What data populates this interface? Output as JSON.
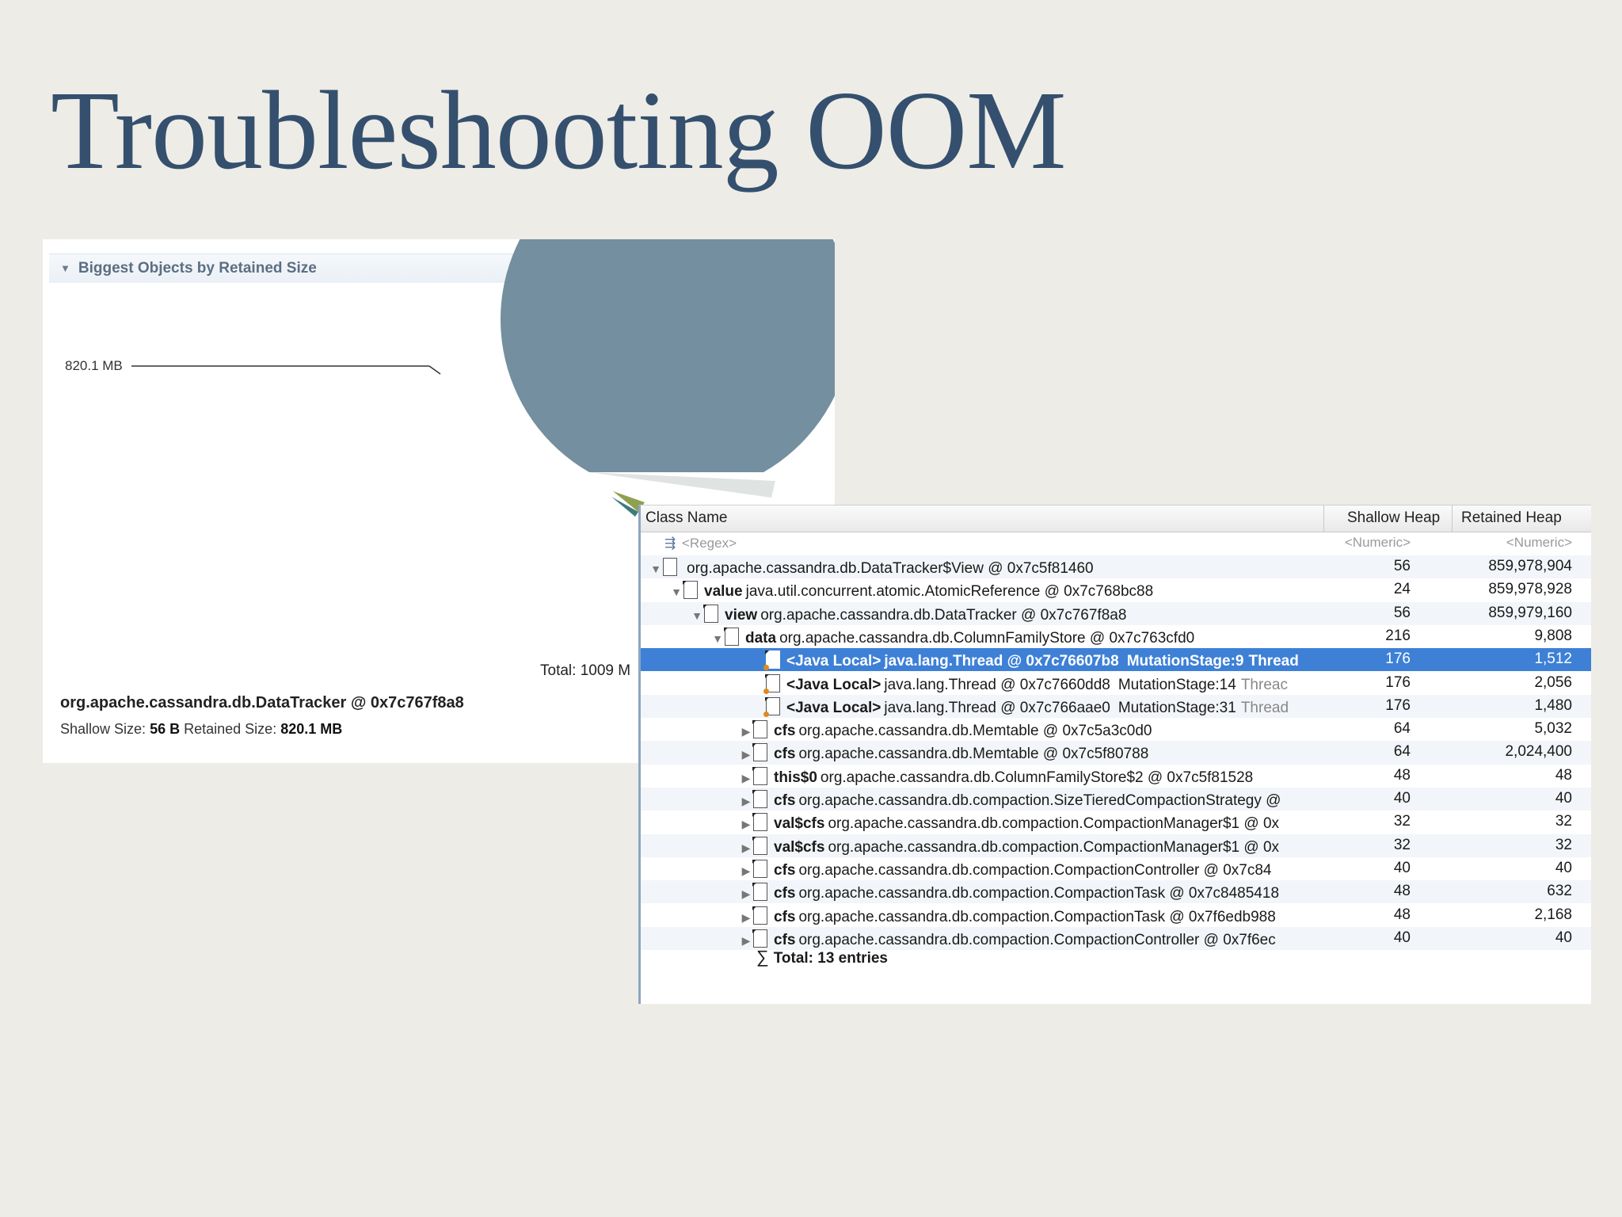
{
  "slide_title": "Troubleshooting OOM",
  "pie_panel": {
    "header": "Biggest Objects by Retained Size",
    "callout_label": "820.1 MB",
    "total_label": "Total: 1009 M",
    "object_name": "org.apache.cassandra.db.DataTracker @ 0x7c767f8a8",
    "shallow_label": "Shallow Size:",
    "shallow_value": "56 B",
    "retained_label": "Retained Size:",
    "retained_value": "820.1 MB",
    "colors": {
      "main_slice": "#748f9f",
      "slice_green": "#8fa050",
      "slice_teal": "#3e7b7c",
      "slice_light": "#dfe3e2"
    }
  },
  "table": {
    "headers": {
      "class_name": "Class Name",
      "shallow": "Shallow Heap",
      "retained": "Retained Heap"
    },
    "filter": {
      "name": "<Regex>",
      "shallow": "<Numeric>",
      "retained": "<Numeric>"
    },
    "rows": [
      {
        "arrow": "▼",
        "ref": "",
        "name": "org.apache.cassandra.db.DataTracker$View @ 0x7c5f81460",
        "suffix": "",
        "suffix_grey": "",
        "shallow": "56",
        "retained": "859,978,904"
      },
      {
        "arrow": "▼",
        "ref": "value",
        "name": "java.util.concurrent.atomic.AtomicReference @ 0x7c768bc88",
        "suffix": "",
        "suffix_grey": "",
        "shallow": "24",
        "retained": "859,978,928"
      },
      {
        "arrow": "▼",
        "ref": "view",
        "name": "org.apache.cassandra.db.DataTracker @ 0x7c767f8a8",
        "suffix": "",
        "suffix_grey": "",
        "shallow": "56",
        "retained": "859,979,160"
      },
      {
        "arrow": "▼",
        "ref": "data",
        "name": "org.apache.cassandra.db.ColumnFamilyStore @ 0x7c763cfd0",
        "suffix": "",
        "suffix_grey": "",
        "shallow": "216",
        "retained": "9,808"
      },
      {
        "arrow": "",
        "ref": "<Java Local>",
        "name": "java.lang.Thread @ 0x7c76607b8",
        "suffix": "MutationStage:9",
        "suffix_grey": "Thread",
        "shallow": "176",
        "retained": "1,512"
      },
      {
        "arrow": "",
        "ref": "<Java Local>",
        "name": "java.lang.Thread @ 0x7c7660dd8",
        "suffix": "MutationStage:14",
        "suffix_grey": "Threac",
        "shallow": "176",
        "retained": "2,056"
      },
      {
        "arrow": "",
        "ref": "<Java Local>",
        "name": "java.lang.Thread @ 0x7c766aae0",
        "suffix": "MutationStage:31",
        "suffix_grey": "Thread",
        "shallow": "176",
        "retained": "1,480"
      },
      {
        "arrow": "▶",
        "ref": "cfs",
        "name": "org.apache.cassandra.db.Memtable @ 0x7c5a3c0d0",
        "suffix": "",
        "suffix_grey": "",
        "shallow": "64",
        "retained": "5,032"
      },
      {
        "arrow": "▶",
        "ref": "cfs",
        "name": "org.apache.cassandra.db.Memtable @ 0x7c5f80788",
        "suffix": "",
        "suffix_grey": "",
        "shallow": "64",
        "retained": "2,024,400"
      },
      {
        "arrow": "▶",
        "ref": "this$0",
        "name": "org.apache.cassandra.db.ColumnFamilyStore$2 @ 0x7c5f81528",
        "suffix": "",
        "suffix_grey": "",
        "shallow": "48",
        "retained": "48"
      },
      {
        "arrow": "▶",
        "ref": "cfs",
        "name": "org.apache.cassandra.db.compaction.SizeTieredCompactionStrategy @",
        "suffix": "",
        "suffix_grey": "",
        "shallow": "40",
        "retained": "40"
      },
      {
        "arrow": "▶",
        "ref": "val$cfs",
        "name": "org.apache.cassandra.db.compaction.CompactionManager$1 @ 0x",
        "suffix": "",
        "suffix_grey": "",
        "shallow": "32",
        "retained": "32"
      },
      {
        "arrow": "▶",
        "ref": "val$cfs",
        "name": "org.apache.cassandra.db.compaction.CompactionManager$1 @ 0x",
        "suffix": "",
        "suffix_grey": "",
        "shallow": "32",
        "retained": "32"
      },
      {
        "arrow": "▶",
        "ref": "cfs",
        "name": "org.apache.cassandra.db.compaction.CompactionController @ 0x7c84",
        "suffix": "",
        "suffix_grey": "",
        "shallow": "40",
        "retained": "40"
      },
      {
        "arrow": "▶",
        "ref": "cfs",
        "name": "org.apache.cassandra.db.compaction.CompactionTask @ 0x7c8485418",
        "suffix": "",
        "suffix_grey": "",
        "shallow": "48",
        "retained": "632"
      },
      {
        "arrow": "▶",
        "ref": "cfs",
        "name": "org.apache.cassandra.db.compaction.CompactionTask @ 0x7f6edb988",
        "suffix": "",
        "suffix_grey": "",
        "shallow": "48",
        "retained": "2,168"
      },
      {
        "arrow": "▶",
        "ref": "cfs",
        "name": "org.apache.cassandra.db.compaction.CompactionController @ 0x7f6ec",
        "suffix": "",
        "suffix_grey": "",
        "shallow": "40",
        "retained": "40"
      }
    ],
    "total": "Total: 13 entries",
    "selection_color": "#3d80d6"
  }
}
